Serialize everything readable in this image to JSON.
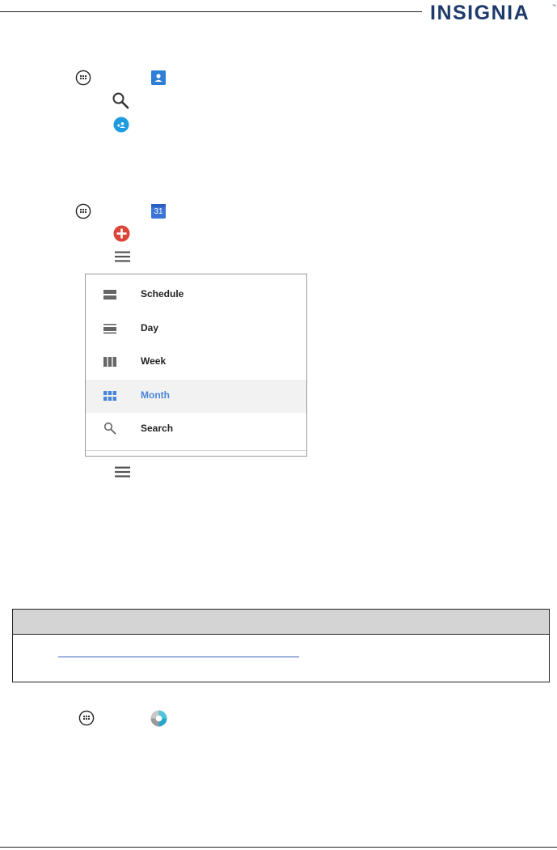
{
  "header": {
    "brand": "INSIGNIA",
    "trademark": "™"
  },
  "calendar_menu": {
    "items": [
      {
        "label": "Schedule",
        "icon": "schedule-view-icon",
        "active": false
      },
      {
        "label": "Day",
        "icon": "day-view-icon",
        "active": false
      },
      {
        "label": "Week",
        "icon": "week-view-icon",
        "active": false
      },
      {
        "label": "Month",
        "icon": "month-view-icon",
        "active": true
      },
      {
        "label": "Search",
        "icon": "search-icon",
        "active": false
      }
    ]
  },
  "icons": {
    "apps": "apps-icon",
    "contacts": "contacts-icon",
    "search": "search-icon",
    "add_contact": "add-contact-icon",
    "calendar": "calendar-icon",
    "calendar_day_number": "31",
    "add_event": "add-event-icon",
    "menu": "menu-icon",
    "photos": "photos-icon"
  },
  "colors": {
    "brand": "#1e3a6b",
    "accent_blue": "#4a86d8",
    "add_red": "#db4437",
    "contacts_blue": "#2f7fd6",
    "skype_blue": "#1e9be0"
  }
}
